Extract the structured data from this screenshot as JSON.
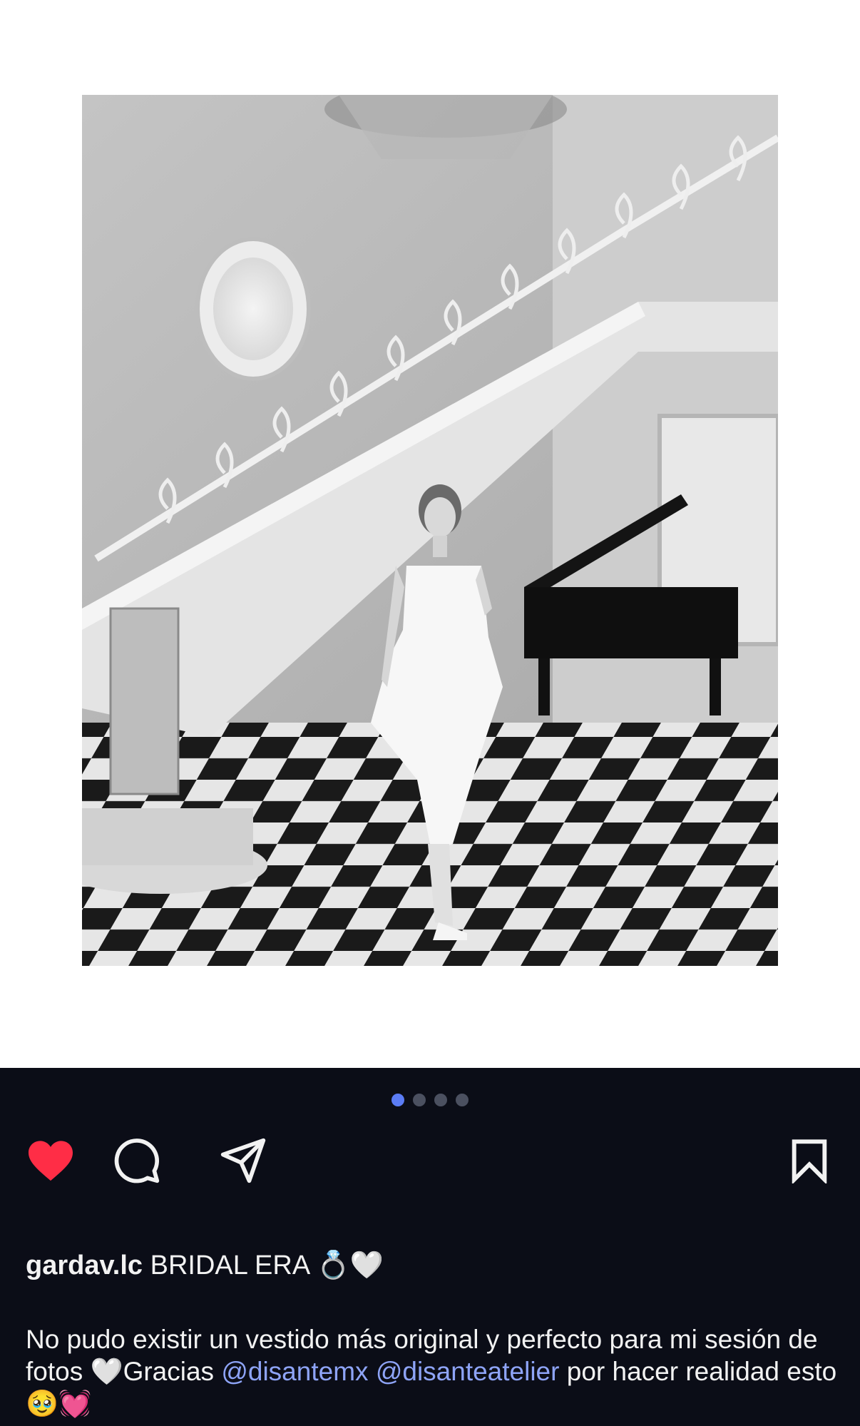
{
  "post": {
    "image_alt": "Black and white photo of a woman in a white strapless dress standing on a checkered floor in front of a curved staircase, chandelier and grand piano",
    "carousel": {
      "count": 4,
      "active_index": 0
    },
    "liked": true,
    "author": "gardav.lc",
    "caption_title": "BRIDAL ERA 💍🤍",
    "caption": {
      "part1": "No pudo existir un vestido más original y perfecto para mi sesión de fotos 🤍Gracias ",
      "mention1": "@disantemx",
      "space": " ",
      "mention2": "@disanteatelier",
      "part2": " por hacer realidad esto 🥹💓"
    }
  },
  "icons": {
    "like": "heart-filled-icon",
    "comment": "speech-bubble-icon",
    "share": "paper-plane-icon",
    "save": "bookmark-icon"
  },
  "colors": {
    "panel_bg": "#0b0d17",
    "like_red": "#ff2d46",
    "mention_blue": "#8ea4f7",
    "dot_active": "#5b7cf5",
    "dot_inactive": "#4b5060"
  }
}
